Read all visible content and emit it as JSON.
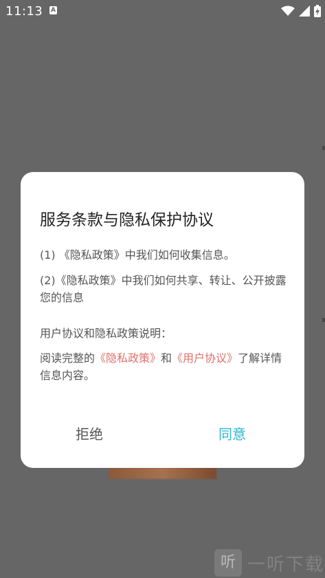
{
  "status_bar": {
    "time": "11:13",
    "indicator": "A",
    "icons": [
      "wifi-icon",
      "signal-icon",
      "battery-charging-icon"
    ]
  },
  "dialog": {
    "title": "服务条款与隐私保护协议",
    "paragraph1": "(1) 《隐私政策》中我们如何收集信息。",
    "paragraph2": "(2)《隐私政策》中我们如何共享、转让、公开披露您的信息",
    "paragraph3": "用户协议和隐私政策说明：",
    "paragraph4_prefix": "阅读完整的",
    "privacy_link": "《隐私政策》",
    "paragraph4_and": "和",
    "user_agreement_link": "《用户协议》",
    "paragraph4_suffix": "了解详情信息内容。",
    "reject_label": "拒绝",
    "agree_label": "同意"
  },
  "watermark": {
    "logo_char": "听",
    "text": "一听下载"
  },
  "colors": {
    "overlay": "#666666",
    "link": "#e0706c",
    "agree": "#2bb7d0",
    "text": "#555555",
    "title": "#222222"
  }
}
